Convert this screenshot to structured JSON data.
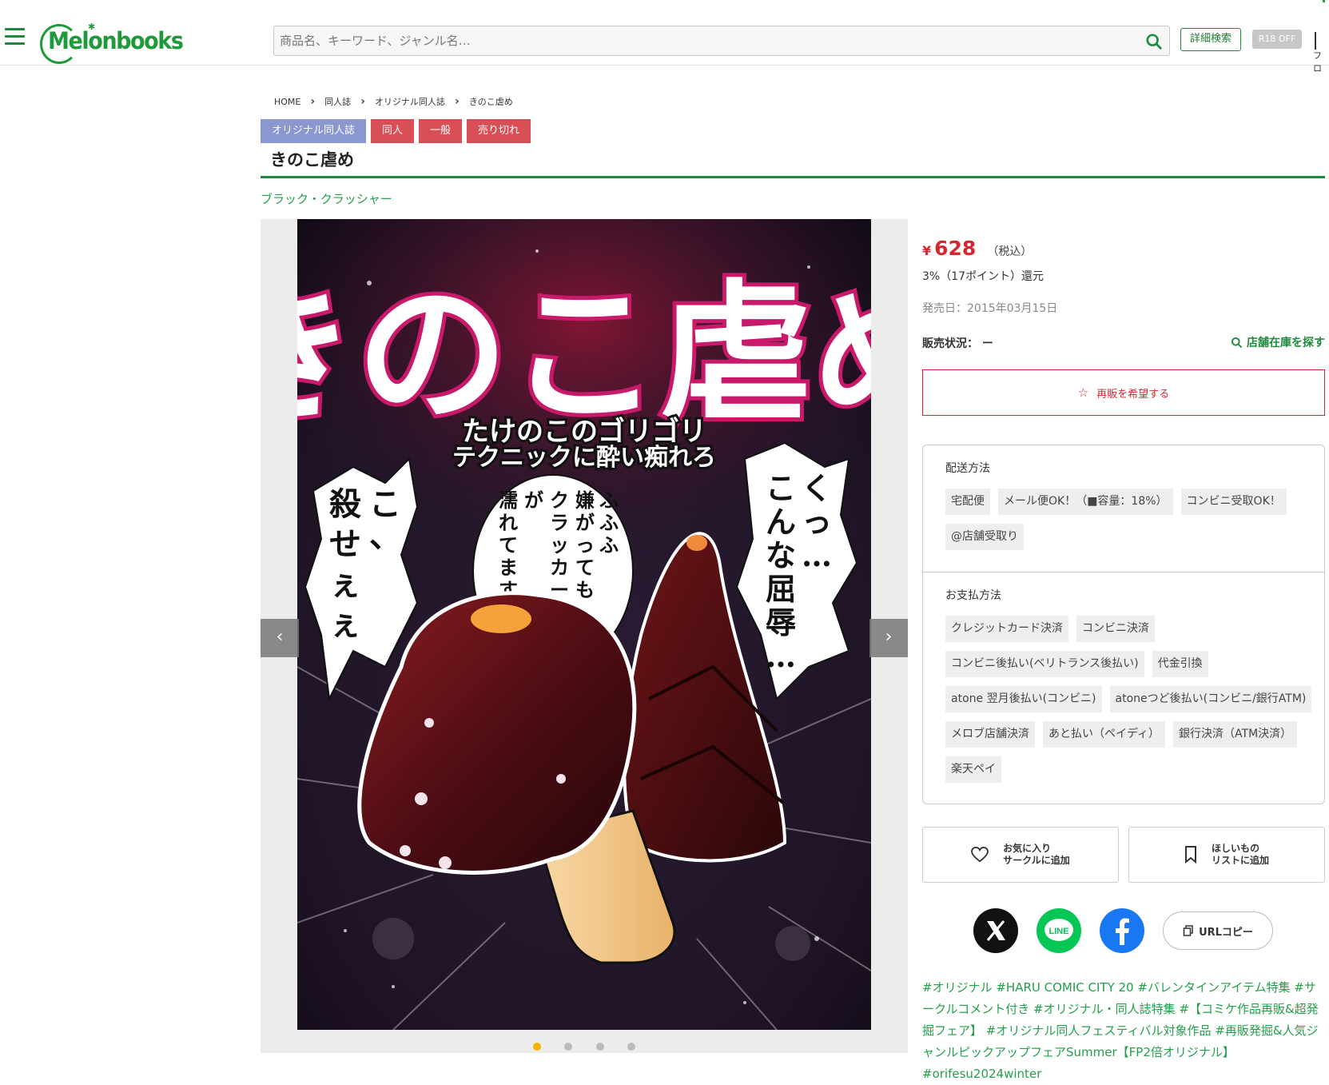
{
  "header": {
    "logo_text": "Melonbooks",
    "search_placeholder": "商品名、キーワード、ジャンル名…",
    "advanced_search_label": "詳細検索",
    "r18_label": "R18 OFF",
    "cut_text": "フロ"
  },
  "breadcrumb": [
    "HOME",
    "同人誌",
    "オリジナル同人誌",
    "きのこ虐め"
  ],
  "tags": [
    {
      "label": "オリジナル同人誌",
      "color": "#8b97cf"
    },
    {
      "label": "同人",
      "color": "#d84f55"
    },
    {
      "label": "一般",
      "color": "#d84f55"
    },
    {
      "label": "売り切れ",
      "color": "#d84f55"
    }
  ],
  "product": {
    "title": "きのこ虐め",
    "circle": "ブラック・クラッシャー",
    "currency": "¥",
    "price": "628",
    "tax_note": "（税込）",
    "points": "3%（17ポイント）還元",
    "release": "発売日：2015年03月15日",
    "status": "販売状況：  ー",
    "store_search": "店舗在庫を探す",
    "restock_label": "再販を希望する"
  },
  "cover": {
    "title": "きのこ虐め",
    "subtitle_line1": "たけのこのゴリゴリ",
    "subtitle_line2": "テクニックに酔い痴れろ",
    "bubble_left": [
      "こ、",
      "殺せぇぇ"
    ],
    "bubble_center": [
      "ふふふ",
      "嫌がっても",
      "クラッカー軸が",
      "濡れてますね"
    ],
    "bubble_right": [
      "くっ…",
      "こんな屈辱…"
    ]
  },
  "carousel": {
    "slides": 4,
    "active": 0
  },
  "shipping": {
    "title": "配送方法",
    "methods": [
      "宅配便",
      "メール便OK！（■容量：18%）",
      "コンビニ受取OK！",
      "@店舗受取り"
    ]
  },
  "payment": {
    "title": "お支払方法",
    "methods": [
      "クレジットカード決済",
      "コンビニ決済",
      "コンビニ後払い(ベリトランス後払い)",
      "代金引換",
      "atone 翌月後払い(コンビニ)",
      "atoneつど後払い(コンビニ/銀行ATM)",
      "メロブ店舗決済",
      "あと払い（ペイディ）",
      "銀行決済（ATM決済）",
      "楽天ペイ"
    ]
  },
  "actions": {
    "favorite_line1": "お気に入り",
    "favorite_line2": "サークルに追加",
    "wishlist_line1": "ほしいもの",
    "wishlist_line2": "リストに追加"
  },
  "share": {
    "line_label": "LINE",
    "url_copy_label": "URLコピー"
  },
  "hashtags": [
    "#オリジナル",
    "#HARU COMIC CITY 20",
    "#バレンタインアイテム特集",
    "#サークルコメント付き",
    "#オリジナル・同人誌特集",
    "#【コミケ作品再販&超発掘フェア】",
    "#オリジナル同人フェスティバル対象作品",
    "#再販発掘&人気ジャンルピックアップフェアSummer【FP2倍オリジナル】",
    "#orifesu2024winter"
  ],
  "colors": {
    "brand_green": "#1f8a3c",
    "price_red": "#d6272f",
    "link_green": "#22a04a",
    "tag_blue": "#8b97cf",
    "tag_red": "#d84f55"
  }
}
